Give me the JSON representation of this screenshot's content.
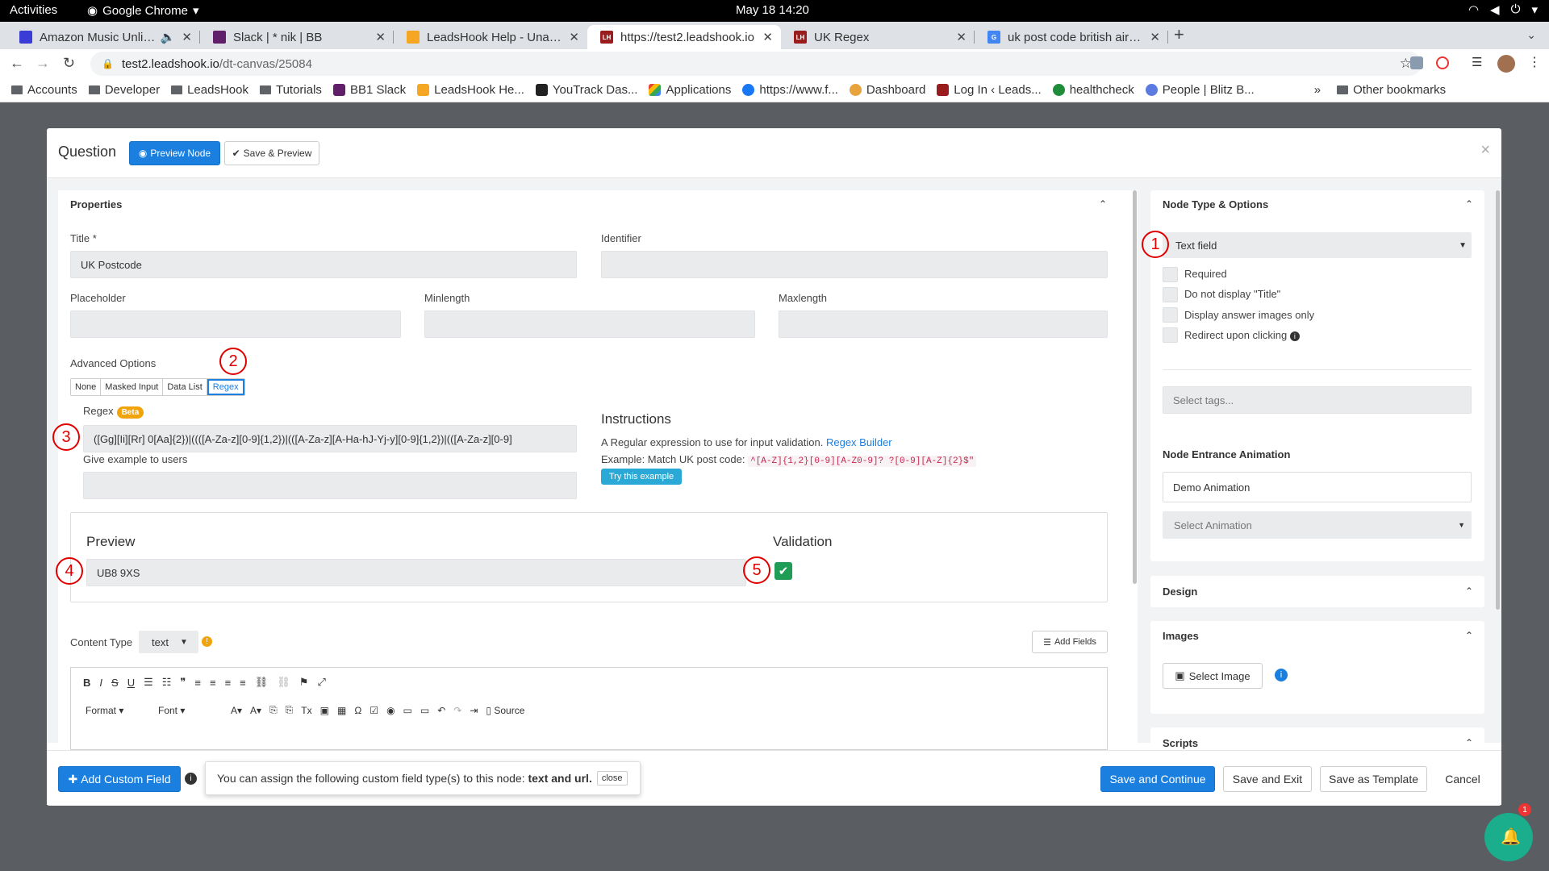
{
  "os": {
    "activities": "Activities",
    "app_name": "Google Chrome",
    "clock": "May 18  14:20"
  },
  "tabs": [
    {
      "title": "Amazon Music Unlimit",
      "color": "#3b3bd6"
    },
    {
      "title": "Slack | * nik | BB",
      "color": "#611f69"
    },
    {
      "title": "LeadsHook Help - Unassig",
      "color": "#f5a623"
    },
    {
      "title": "https://test2.leadshook.io",
      "color": "#9b1c1c"
    },
    {
      "title": "UK Regex",
      "color": "#9b1c1c"
    },
    {
      "title": "uk post code british airwa",
      "color": "#4285f4"
    }
  ],
  "address": {
    "host": "test2.leadshook.io",
    "path": "/dt-canvas/25084"
  },
  "bookmarks": [
    "Accounts",
    "Developer",
    "LeadsHook",
    "Tutorials",
    "BB1 Slack",
    "LeadsHook He...",
    "YouTrack Das...",
    "Applications",
    "https://www.f...",
    "Dashboard",
    "Log In ‹ Leads...",
    "healthcheck",
    "People | Blitz B...",
    "»",
    "Other bookmarks"
  ],
  "modal": {
    "title": "Question",
    "preview_node": "Preview Node",
    "save_preview": "Save & Preview",
    "close": "×"
  },
  "properties": {
    "header": "Properties",
    "title_label": "Title *",
    "title_value": "UK Postcode",
    "identifier_label": "Identifier",
    "identifier_value": "",
    "placeholder_label": "Placeholder",
    "minlength_label": "Minlength",
    "maxlength_label": "Maxlength",
    "advanced_label": "Advanced Options",
    "advanced_options": [
      "None",
      "Masked Input",
      "Data List",
      "Regex"
    ],
    "regex_label": "Regex",
    "beta": "Beta",
    "regex_value": "([Gg][Ii][Rr] 0[Aa]{2})|((([A-Za-z][0-9]{1,2})|(([A-Za-z][A-Ha-hJ-Yj-y][0-9]{1,2})|(([A-Za-z][0-9]",
    "example_label": "Give example to users",
    "instructions_title": "Instructions",
    "instructions_text": "A Regular expression to use for input validation.",
    "regex_builder": "Regex Builder",
    "example_text": "Example: Match UK post code:",
    "example_code": "^[A-Z]{1,2}[0-9][A-Z0-9]? ?[0-9][A-Z]{2}$\"",
    "try_example": "Try this example",
    "preview_label": "Preview",
    "preview_value": "UB8 9XS",
    "validation_label": "Validation",
    "content_type_label": "Content Type",
    "content_type_value": "text",
    "add_fields": "Add Fields",
    "format": "Format",
    "font": "Font",
    "source": "Source"
  },
  "annotations": [
    "1",
    "2",
    "3",
    "4",
    "5"
  ],
  "node_type": {
    "header": "Node Type & Options",
    "type_value": "Text field",
    "options": [
      "Required",
      "Do not display \"Title\"",
      "Display answer images only",
      "Redirect upon clicking"
    ],
    "tags_placeholder": "Select tags...",
    "animation_header": "Node Entrance Animation",
    "animation_name": "Demo Animation",
    "select_animation": "Select Animation"
  },
  "design": {
    "header": "Design"
  },
  "images": {
    "header": "Images",
    "select_image": "Select Image"
  },
  "scripts": {
    "header": "Scripts"
  },
  "footer": {
    "add_custom_field": "Add Custom Field",
    "tooltip_text": "You can assign the following custom field type(s) to this node:",
    "tooltip_types": "text and url.",
    "tooltip_close": "close",
    "save_continue": "Save and Continue",
    "save_exit": "Save and Exit",
    "save_template": "Save as Template",
    "cancel": "Cancel"
  },
  "chat_badge": "1"
}
